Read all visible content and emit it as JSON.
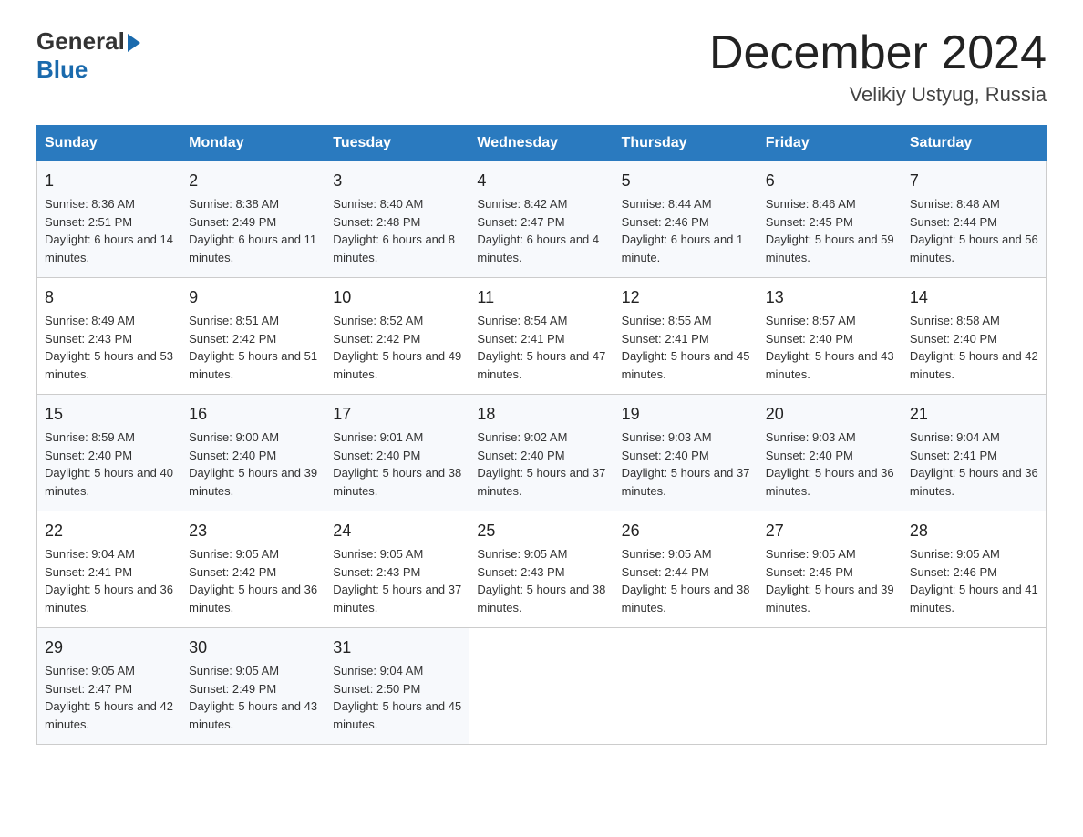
{
  "header": {
    "logo_general": "General",
    "logo_blue": "Blue",
    "month_year": "December 2024",
    "location": "Velikiy Ustyug, Russia"
  },
  "weekdays": [
    "Sunday",
    "Monday",
    "Tuesday",
    "Wednesday",
    "Thursday",
    "Friday",
    "Saturday"
  ],
  "weeks": [
    [
      {
        "day": "1",
        "sunrise": "Sunrise: 8:36 AM",
        "sunset": "Sunset: 2:51 PM",
        "daylight": "Daylight: 6 hours and 14 minutes."
      },
      {
        "day": "2",
        "sunrise": "Sunrise: 8:38 AM",
        "sunset": "Sunset: 2:49 PM",
        "daylight": "Daylight: 6 hours and 11 minutes."
      },
      {
        "day": "3",
        "sunrise": "Sunrise: 8:40 AM",
        "sunset": "Sunset: 2:48 PM",
        "daylight": "Daylight: 6 hours and 8 minutes."
      },
      {
        "day": "4",
        "sunrise": "Sunrise: 8:42 AM",
        "sunset": "Sunset: 2:47 PM",
        "daylight": "Daylight: 6 hours and 4 minutes."
      },
      {
        "day": "5",
        "sunrise": "Sunrise: 8:44 AM",
        "sunset": "Sunset: 2:46 PM",
        "daylight": "Daylight: 6 hours and 1 minute."
      },
      {
        "day": "6",
        "sunrise": "Sunrise: 8:46 AM",
        "sunset": "Sunset: 2:45 PM",
        "daylight": "Daylight: 5 hours and 59 minutes."
      },
      {
        "day": "7",
        "sunrise": "Sunrise: 8:48 AM",
        "sunset": "Sunset: 2:44 PM",
        "daylight": "Daylight: 5 hours and 56 minutes."
      }
    ],
    [
      {
        "day": "8",
        "sunrise": "Sunrise: 8:49 AM",
        "sunset": "Sunset: 2:43 PM",
        "daylight": "Daylight: 5 hours and 53 minutes."
      },
      {
        "day": "9",
        "sunrise": "Sunrise: 8:51 AM",
        "sunset": "Sunset: 2:42 PM",
        "daylight": "Daylight: 5 hours and 51 minutes."
      },
      {
        "day": "10",
        "sunrise": "Sunrise: 8:52 AM",
        "sunset": "Sunset: 2:42 PM",
        "daylight": "Daylight: 5 hours and 49 minutes."
      },
      {
        "day": "11",
        "sunrise": "Sunrise: 8:54 AM",
        "sunset": "Sunset: 2:41 PM",
        "daylight": "Daylight: 5 hours and 47 minutes."
      },
      {
        "day": "12",
        "sunrise": "Sunrise: 8:55 AM",
        "sunset": "Sunset: 2:41 PM",
        "daylight": "Daylight: 5 hours and 45 minutes."
      },
      {
        "day": "13",
        "sunrise": "Sunrise: 8:57 AM",
        "sunset": "Sunset: 2:40 PM",
        "daylight": "Daylight: 5 hours and 43 minutes."
      },
      {
        "day": "14",
        "sunrise": "Sunrise: 8:58 AM",
        "sunset": "Sunset: 2:40 PM",
        "daylight": "Daylight: 5 hours and 42 minutes."
      }
    ],
    [
      {
        "day": "15",
        "sunrise": "Sunrise: 8:59 AM",
        "sunset": "Sunset: 2:40 PM",
        "daylight": "Daylight: 5 hours and 40 minutes."
      },
      {
        "day": "16",
        "sunrise": "Sunrise: 9:00 AM",
        "sunset": "Sunset: 2:40 PM",
        "daylight": "Daylight: 5 hours and 39 minutes."
      },
      {
        "day": "17",
        "sunrise": "Sunrise: 9:01 AM",
        "sunset": "Sunset: 2:40 PM",
        "daylight": "Daylight: 5 hours and 38 minutes."
      },
      {
        "day": "18",
        "sunrise": "Sunrise: 9:02 AM",
        "sunset": "Sunset: 2:40 PM",
        "daylight": "Daylight: 5 hours and 37 minutes."
      },
      {
        "day": "19",
        "sunrise": "Sunrise: 9:03 AM",
        "sunset": "Sunset: 2:40 PM",
        "daylight": "Daylight: 5 hours and 37 minutes."
      },
      {
        "day": "20",
        "sunrise": "Sunrise: 9:03 AM",
        "sunset": "Sunset: 2:40 PM",
        "daylight": "Daylight: 5 hours and 36 minutes."
      },
      {
        "day": "21",
        "sunrise": "Sunrise: 9:04 AM",
        "sunset": "Sunset: 2:41 PM",
        "daylight": "Daylight: 5 hours and 36 minutes."
      }
    ],
    [
      {
        "day": "22",
        "sunrise": "Sunrise: 9:04 AM",
        "sunset": "Sunset: 2:41 PM",
        "daylight": "Daylight: 5 hours and 36 minutes."
      },
      {
        "day": "23",
        "sunrise": "Sunrise: 9:05 AM",
        "sunset": "Sunset: 2:42 PM",
        "daylight": "Daylight: 5 hours and 36 minutes."
      },
      {
        "day": "24",
        "sunrise": "Sunrise: 9:05 AM",
        "sunset": "Sunset: 2:43 PM",
        "daylight": "Daylight: 5 hours and 37 minutes."
      },
      {
        "day": "25",
        "sunrise": "Sunrise: 9:05 AM",
        "sunset": "Sunset: 2:43 PM",
        "daylight": "Daylight: 5 hours and 38 minutes."
      },
      {
        "day": "26",
        "sunrise": "Sunrise: 9:05 AM",
        "sunset": "Sunset: 2:44 PM",
        "daylight": "Daylight: 5 hours and 38 minutes."
      },
      {
        "day": "27",
        "sunrise": "Sunrise: 9:05 AM",
        "sunset": "Sunset: 2:45 PM",
        "daylight": "Daylight: 5 hours and 39 minutes."
      },
      {
        "day": "28",
        "sunrise": "Sunrise: 9:05 AM",
        "sunset": "Sunset: 2:46 PM",
        "daylight": "Daylight: 5 hours and 41 minutes."
      }
    ],
    [
      {
        "day": "29",
        "sunrise": "Sunrise: 9:05 AM",
        "sunset": "Sunset: 2:47 PM",
        "daylight": "Daylight: 5 hours and 42 minutes."
      },
      {
        "day": "30",
        "sunrise": "Sunrise: 9:05 AM",
        "sunset": "Sunset: 2:49 PM",
        "daylight": "Daylight: 5 hours and 43 minutes."
      },
      {
        "day": "31",
        "sunrise": "Sunrise: 9:04 AM",
        "sunset": "Sunset: 2:50 PM",
        "daylight": "Daylight: 5 hours and 45 minutes."
      },
      null,
      null,
      null,
      null
    ]
  ]
}
